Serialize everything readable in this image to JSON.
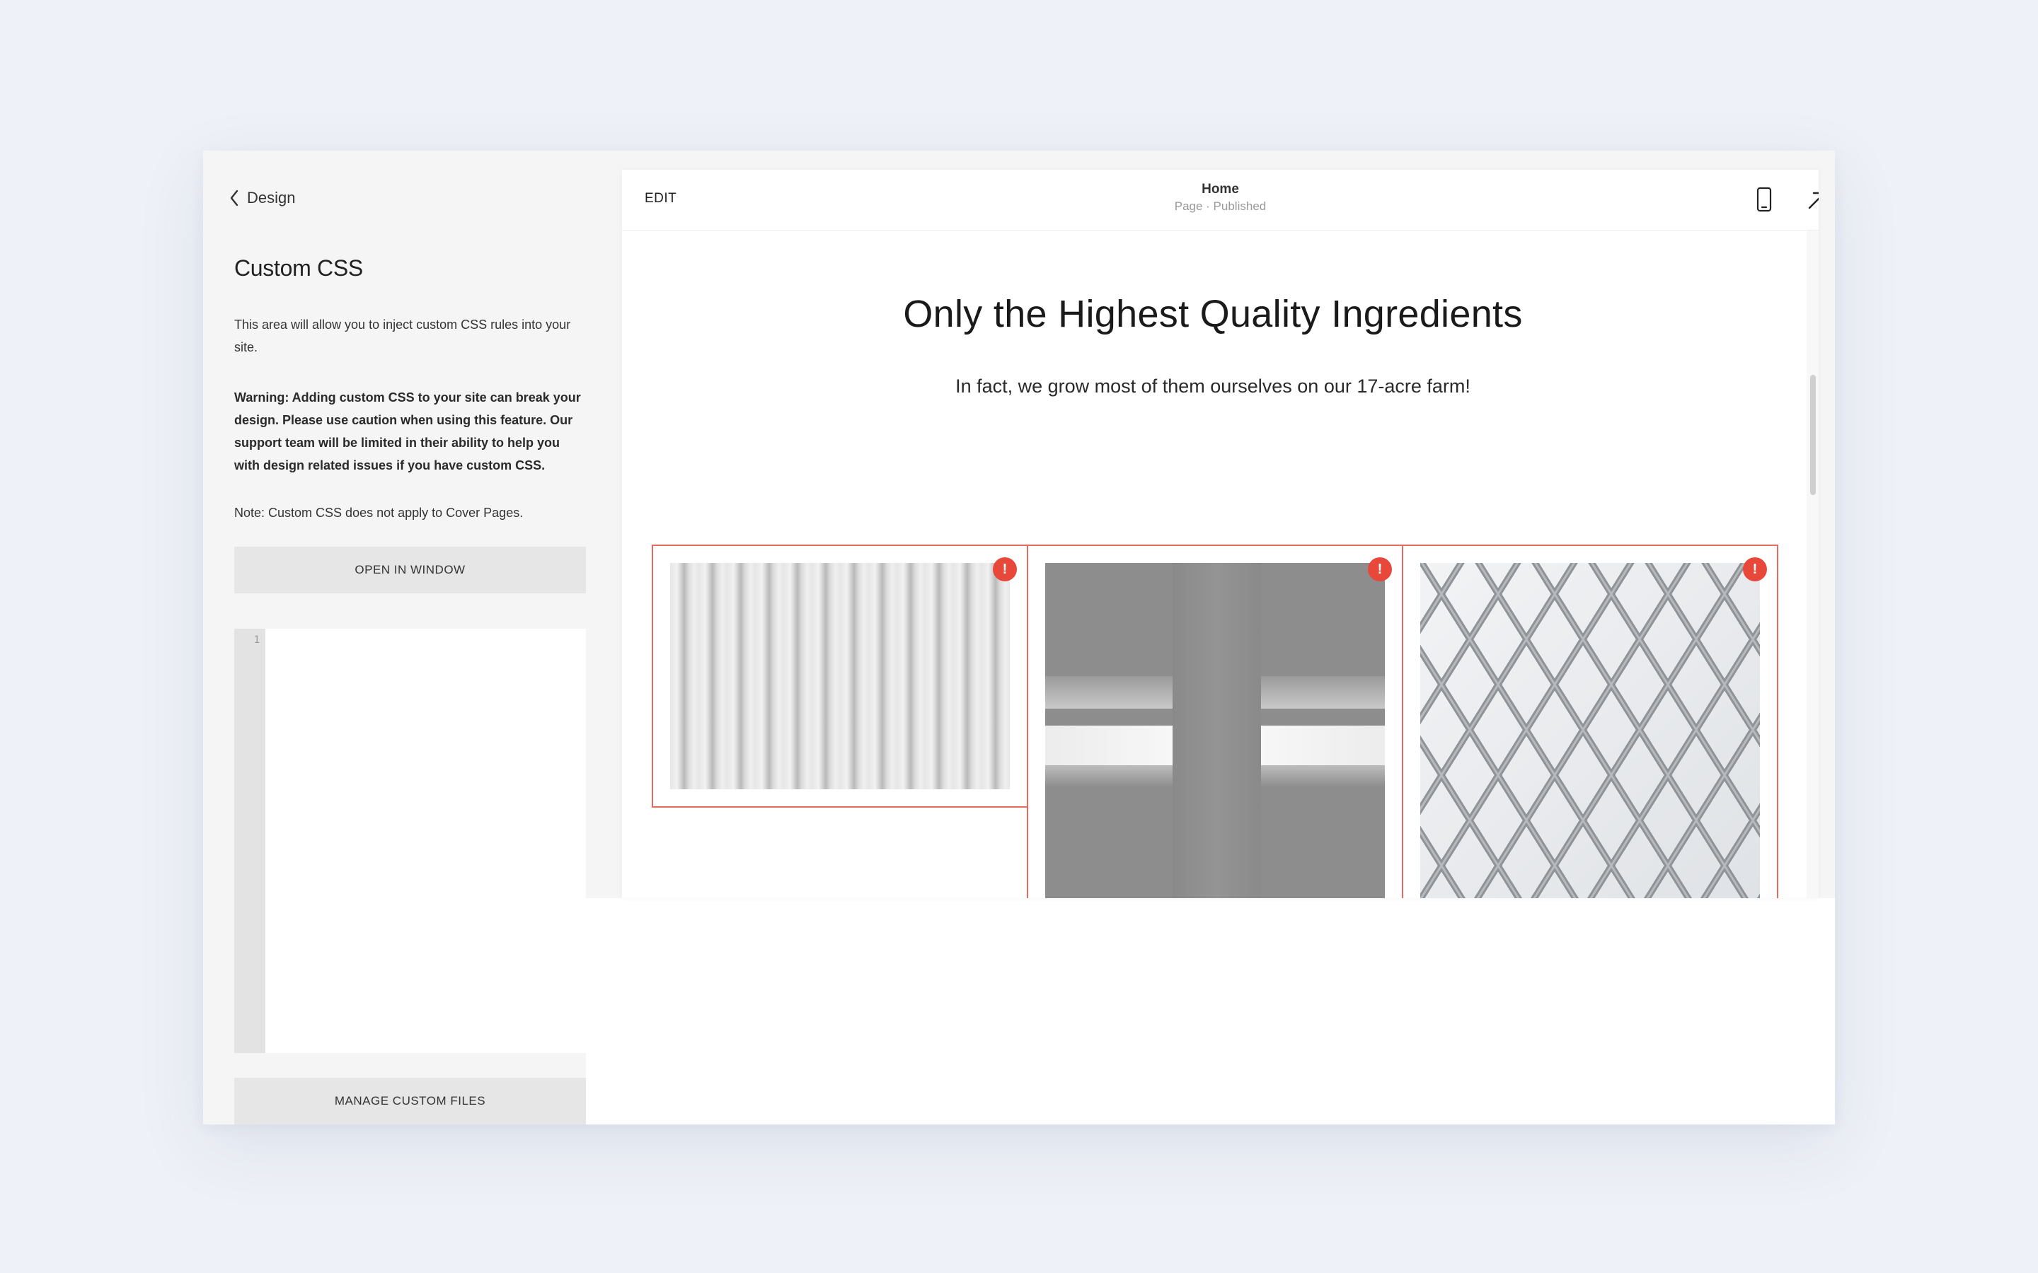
{
  "sidebar": {
    "back_label": "Design",
    "title": "Custom CSS",
    "description": "This area will allow you to inject custom CSS rules into your site.",
    "warning": "Warning: Adding custom CSS to your site can break your design. Please use caution when using this feature. Our support team will be limited in their ability to help you with design related issues if you have custom CSS.",
    "note": "Note: Custom CSS does not apply to Cover Pages.",
    "open_button": "OPEN IN WINDOW",
    "editor_line_number": "1",
    "manage_button": "MANAGE CUSTOM FILES"
  },
  "preview": {
    "edit_label": "EDIT",
    "page_name": "Home",
    "page_status": "Page · Published",
    "icons": [
      "mobile-icon",
      "external-link-icon"
    ],
    "headline": "Only the Highest Quality Ingredients",
    "subhead": "In fact, we grow most of them ourselves on our 17-acre farm!",
    "badge_text": "!",
    "cards": [
      {
        "image": "vertical-ribs-image"
      },
      {
        "image": "gray-architecture-image"
      },
      {
        "image": "lattice-facade-image"
      }
    ]
  },
  "colors": {
    "page_bg": "#eef1f7",
    "sidebar_bg": "#f5f5f5",
    "button_bg": "#e6e6e6",
    "selection_border": "#e76a5e",
    "badge": "#e8483a"
  }
}
